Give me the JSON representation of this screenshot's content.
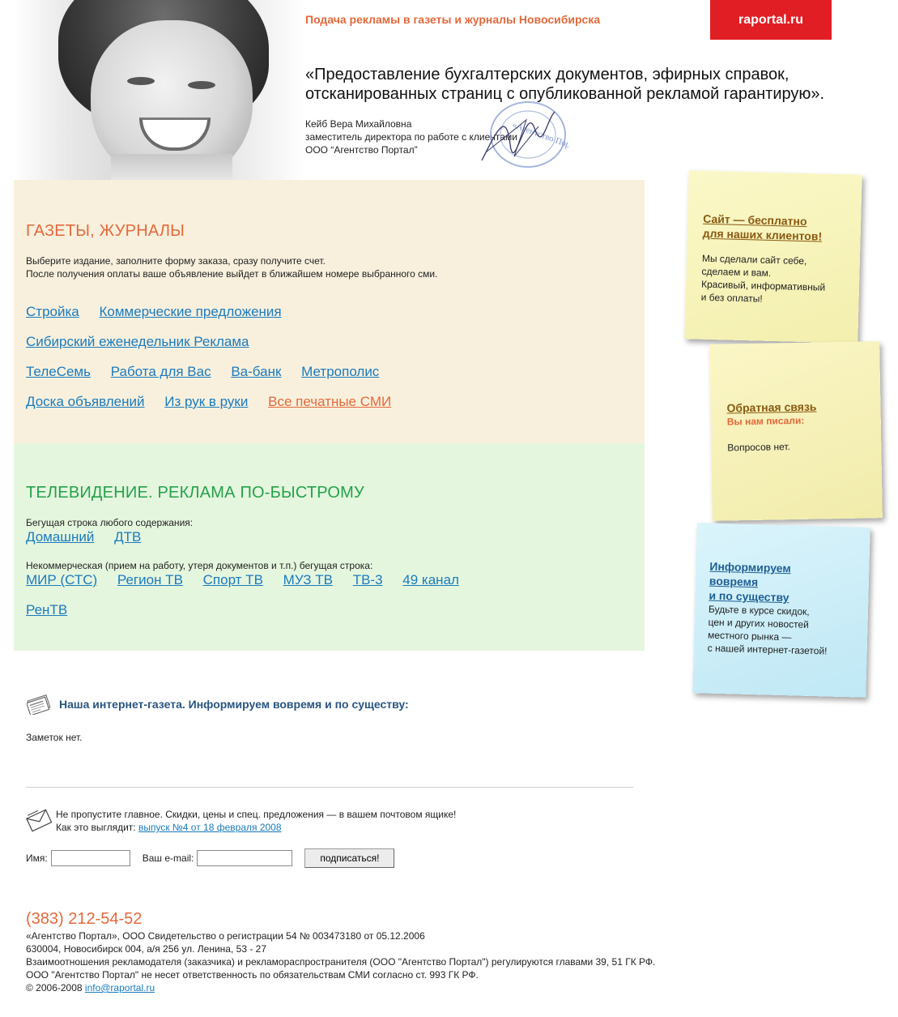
{
  "header": {
    "tagline": "Подача рекламы в газеты и журналы Новосибирска",
    "brand_button": "raportal.ru",
    "quote": "«Предоставление бухгалтерских документов, эфирных справок, отсканированных страниц с опубликованной рекламой гарантирую».",
    "signature": {
      "name": "Кейб Вера Михайловна",
      "position": "заместитель директора по работе с клиентами",
      "company": "ООО “Агентство Портал”"
    },
    "stamp_text": "«Агентство Портал»"
  },
  "press": {
    "title": "ГАЗЕТЫ, ЖУРНАЛЫ",
    "desc_line1": "Выберите издание, заполните форму заказа, сразу получите счет.",
    "desc_line2": "После получения оплаты ваше объявление выйдет в ближайшем номере выбранного сми.",
    "rows": [
      [
        "Стройка",
        "Коммерческие предложения"
      ],
      [
        "Сибирский еженедельник Реклама"
      ],
      [
        "ТелеСемь",
        "Работа для Вас",
        "Ва-банк",
        "Метрополис"
      ],
      [
        "Доска объявлений",
        "Из рук в руки",
        "Все печатные СМИ"
      ]
    ]
  },
  "tv": {
    "title": "ТЕЛЕВИДЕНИЕ. РЕКЛАМА ПО-БЫСТРОМУ",
    "desc1": "Бегущая строка любого содержания:",
    "row1": [
      "Домашний",
      "ДТВ"
    ],
    "desc2": "Некоммерческая (прием на работу, утеря документов и т.п.) бегущая строка:",
    "row2": [
      "МИР (СТС)",
      "Регион ТВ",
      "Спорт ТВ",
      "МУЗ ТВ",
      "ТВ-3",
      "49 канал"
    ],
    "row3": [
      "РенТВ"
    ]
  },
  "notes": {
    "site": {
      "title_line1": "Сайт — бесплатно",
      "title_line2": "для наших клиентов!",
      "text": [
        "Мы сделали сайт себе,",
        "сделаем и вам.",
        "Красивый, информативный",
        "и без оплаты!"
      ]
    },
    "feedback": {
      "title": "Обратная связь",
      "subtitle": "Вы нам писали:",
      "text": "Вопросов нет."
    },
    "inform": {
      "title": [
        "Информируем",
        "вовремя",
        "и по существу"
      ],
      "text": [
        "Будьте в курсе скидок,",
        "цен и других новостей",
        "местного рынка —",
        "с нашей интернет-газетой!"
      ]
    }
  },
  "newspaper": {
    "heading": "Наша интернет-газета. Информируем вовремя и по существу:",
    "empty": "Заметок нет."
  },
  "subscribe": {
    "line1": "Не пропустите главное. Скидки, цены и спец. предложения — в вашем почтовом ящике!",
    "line2_prefix": "Как это выглядит:",
    "line2_link": "выпуск №4 от 18 февраля 2008",
    "name_label": "Имя:",
    "email_label": "Ваш e-mail:",
    "button": "подписаться!"
  },
  "footer": {
    "phone": "(383) 212-54-52",
    "lines": [
      "«Агентство Портал», ООО Свидетельство о регистрации 54 № 003473180 от 05.12.2006",
      "630004, Новосибирск 004, а/я 256 ул. Ленина, 53 - 27",
      "Взаимоотношения рекламодателя (заказчика) и рекламораспространителя (ООО \"Агентство Портал\") регулируются главами 39, 51 ГК РФ.",
      "ООО \"Агентство Портал\" не несет ответственность по обязательствам СМИ согласно ст. 993 ГК РФ."
    ],
    "copyright": "© 2006-2008",
    "email": "info@raportal.ru"
  },
  "colors": {
    "accent_orange": "#e4693b",
    "brand_red": "#e21e25",
    "link_blue": "#1a7bbf",
    "tv_green": "#23a24a",
    "note_title_brown": "#8a5a12"
  }
}
